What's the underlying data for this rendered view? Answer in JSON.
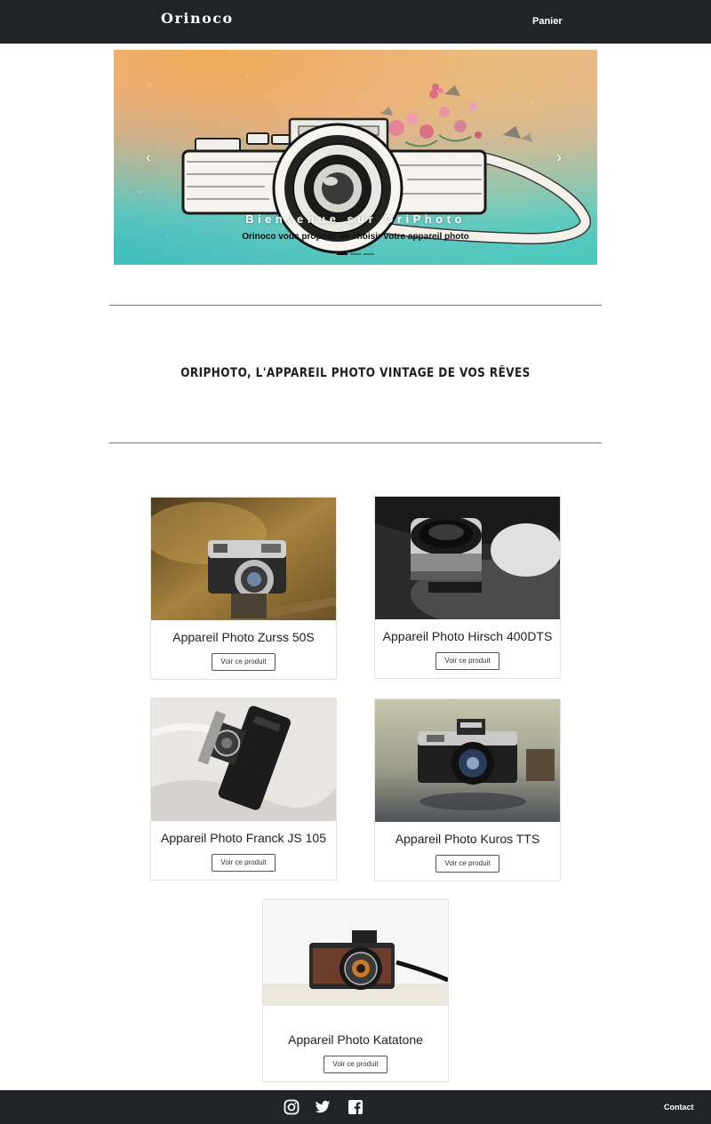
{
  "nav": {
    "brand": "Orinoco",
    "cart_label": "Panier"
  },
  "carousel": {
    "title": "Bienvenue sur OriPhoto",
    "caption": "Orinoco vous propose de choisir votre appareil photo",
    "prev_icon": "chevron-left-icon",
    "next_icon": "chevron-right-icon",
    "slide_count": 3,
    "active_slide": 1
  },
  "tagline": "ORIPHOTO, L'APPAREIL PHOTO VINTAGE DE VOS RÊVES",
  "products": [
    {
      "name": "Appareil Photo Zurss 50S",
      "button": "Voir ce produit"
    },
    {
      "name": "Appareil Photo Hirsch 400DTS",
      "button": "Voir ce produit"
    },
    {
      "name": "Appareil Photo Franck JS 105",
      "button": "Voir ce produit"
    },
    {
      "name": "Appareil Photo Kuros TTS",
      "button": "Voir ce produit"
    },
    {
      "name": "Appareil Photo Katatone",
      "button": "Voir ce produit"
    }
  ],
  "footer": {
    "social_icons": [
      "instagram-icon",
      "twitter-icon",
      "facebook-icon"
    ],
    "contact_label": "Contact"
  },
  "colors": {
    "nav_bg": "#212529",
    "footer_bg": "#212529",
    "text": "#212529"
  }
}
